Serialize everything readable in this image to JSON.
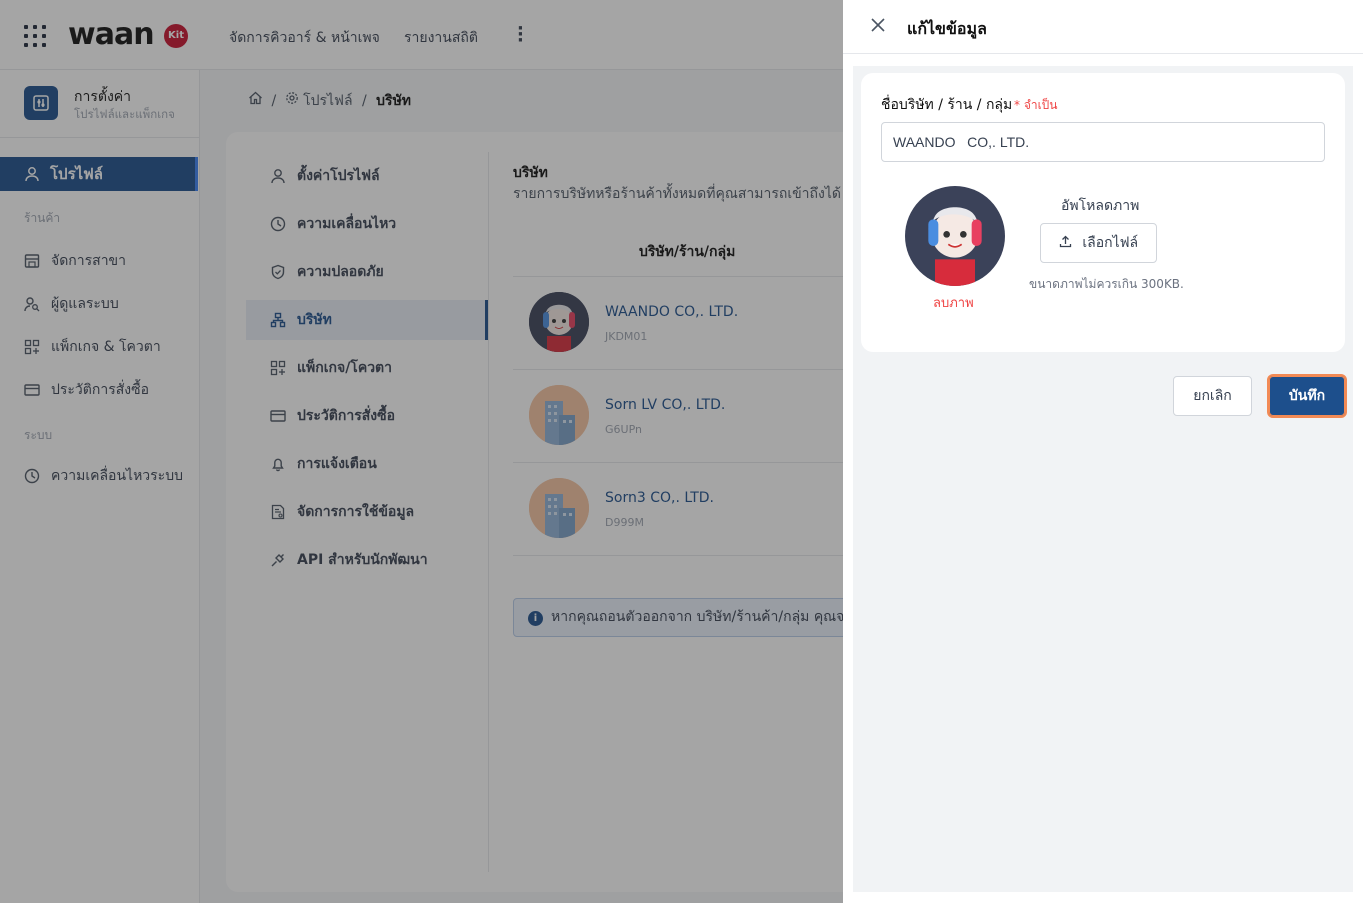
{
  "topbar": {
    "logo": "waan",
    "logo_badge": "Kit",
    "nav_items": [
      "จัดการคิวอาร์ & หน้าเพจ",
      "รายงานสถิติ"
    ]
  },
  "sidebar": {
    "header_title": "การตั้งค่า",
    "header_subtitle": "โปรไฟล์และแพ็กเกจ",
    "active_item": "โปรไฟล์",
    "section_store": "ร้านค้า",
    "store_items": [
      "จัดการสาขา",
      "ผู้ดูแลระบบ",
      "แพ็กเกจ & โควตา",
      "ประวัติการสั่งซื้อ"
    ],
    "section_system": "ระบบ",
    "system_items": [
      "ความเคลื่อนไหวระบบ"
    ]
  },
  "breadcrumb": {
    "profile": "โปรไฟล์",
    "current": "บริษัท",
    "separator": "/"
  },
  "profile_menu": [
    "ตั้งค่าโปรไฟล์",
    "ความเคลื่อนไหว",
    "ความปลอดภัย",
    "บริษัท",
    "แพ็กเกจ/โควตา",
    "ประวัติการสั่งซื้อ",
    "การแจ้งเตือน",
    "จัดการการใช้ข้อมูล",
    "API สำหรับนักพัฒนา"
  ],
  "company_section": {
    "title": "บริษัท",
    "description": "รายการบริษัทหรือร้านค้าทั้งหมดที่คุณสามารถเข้าถึงได้",
    "column_header": "บริษัท/ร้าน/กลุ่ม",
    "companies": [
      {
        "name": "WAANDO CO,. LTD.",
        "code": "JKDM01"
      },
      {
        "name": "Sorn LV CO,. LTD.",
        "code": "G6UPn"
      },
      {
        "name": "Sorn3 CO,. LTD.",
        "code": "D999M"
      }
    ],
    "info_text": "หากคุณถอนตัวออกจาก บริษัท/ร้านค้า/กลุ่ม คุณจะไม่"
  },
  "drawer": {
    "title": "แก้ไขข้อมูล",
    "field_label": "ชื่อบริษัท / ร้าน / กลุ่ม",
    "required_text": "* จำเป็น",
    "field_value": "WAANDO   CO,. LTD.",
    "delete_image": "ลบภาพ",
    "upload_label": "อัพโหลดภาพ",
    "upload_button": "เลือกไฟล์",
    "upload_hint": "ขนาดภาพไม่ควรเกิน 300KB.",
    "cancel_button": "ยกเลิก",
    "save_button": "บันทึก"
  },
  "colors": {
    "primary": "#1d4f8c",
    "required": "#ef4444",
    "focus_ring": "#f28a55",
    "brand_badge": "#c8102e"
  }
}
